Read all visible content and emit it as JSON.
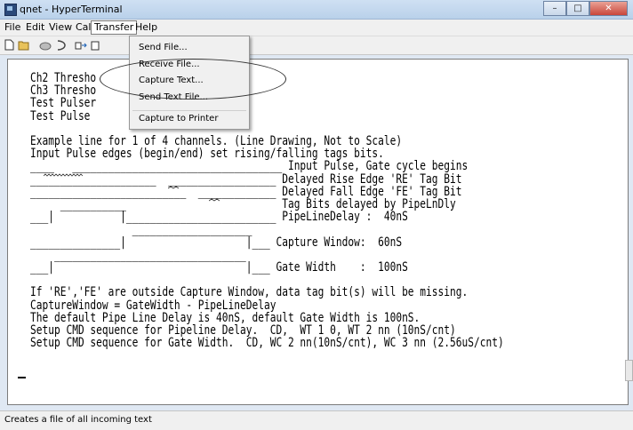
{
  "window": {
    "title": "qnet - HyperTerminal",
    "minimize": "–",
    "maximize": "□",
    "close": "✕"
  },
  "menu": [
    "File",
    "Edit",
    "View",
    "Call",
    "Transfer",
    "Help"
  ],
  "toolbar_icons": [
    "new-icon",
    "open-icon",
    "disconnect-icon",
    "dial-icon",
    "send-icon",
    "receive-icon"
  ],
  "transfer_menu": {
    "items": [
      "Send File...",
      "Receive File...",
      "Capture Text...",
      "Send Text File...",
      "Capture to Printer"
    ],
    "highlighted": "Capture Text..."
  },
  "terminal": {
    "lines": [
      "Ch2 Thresho",
      "Ch3 Thresho",
      "Test Pulser",
      "Test Pulse",
      "",
      "Example line for 1 of 4 channels. (Line Drawing, Not to Scale)",
      "Input Pulse edges (begin/end) set rising/falling tags bits.",
      "____   ___________________________________ Input Pulse, Gate cycle begins",
      "_____________________  __________________ Delayed Rise Edge 'RE' Tag Bit",
      "__________________________  _____________ Delayed Fall Edge 'FE' Tag Bit",
      "     ___________                          Tag Bits delayed by PipeLnDly",
      "___|           |_________________________ PipeLineDelay :  40nS",
      "                 ____________________",
      "_______________|                    |___ Capture Window:  60nS",
      "    ________________________________",
      "___|                                |___ Gate Width    :  100nS",
      "",
      "If 'RE','FE' are outside Capture Window, data tag bit(s) will be missing.",
      "CaptureWindow = GateWidth - PipeLineDelay",
      "The default Pipe Line Delay is 40nS, default Gate Width is 100nS.",
      "Setup CMD sequence for Pipeline Delay.  CD,  WT 1 0, WT 2 nn (10nS/cnt)",
      "Setup CMD sequence for Gate Width.  CD, WC 2 nn(10nS/cnt), WC 3 nn (2.56uS/cnt)"
    ]
  },
  "status": "Creates a file of all incoming text"
}
